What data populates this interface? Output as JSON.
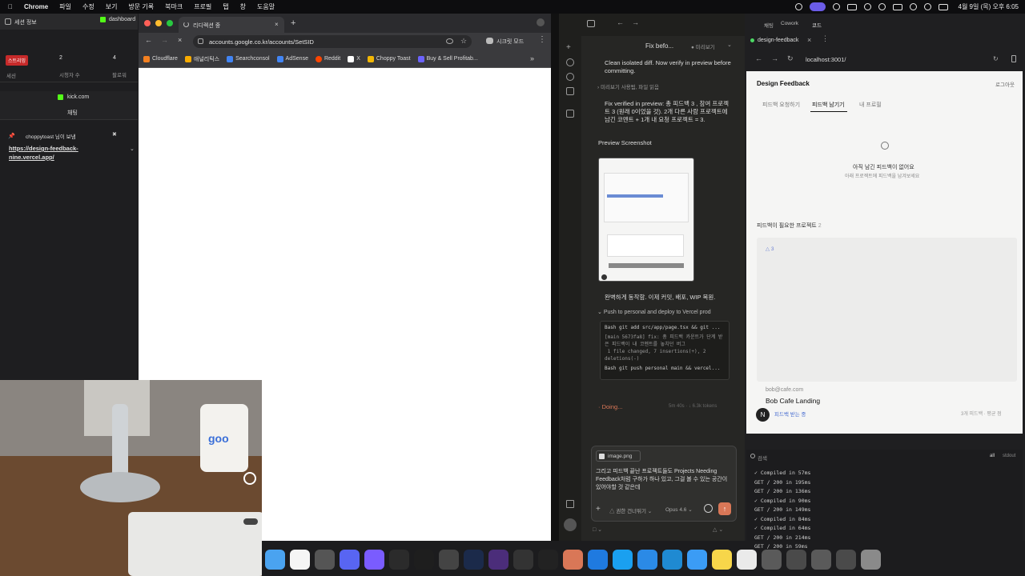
{
  "menubar": {
    "app": "Chrome",
    "items": [
      "파일",
      "수정",
      "보기",
      "방문 기록",
      "북마크",
      "프로필",
      "탭",
      "창",
      "도움말"
    ],
    "datetime": "4월 9일 (목) 오후 6:05"
  },
  "left_panel": {
    "session_title": "세션 정보",
    "dashboard_tab": "dashboard",
    "live_badge": "스트리밍",
    "session_label": "세션",
    "viewers_count": "2",
    "viewers_label": "시청자 수",
    "followers_count": "4",
    "followers_label": "팔로워",
    "kick_title": "kick.com",
    "chat_label": "채팅",
    "pinned_user": "choppytoast 님이 보냄",
    "pinned_link": "https://design-feedback-nine.vercel.app/"
  },
  "chrome": {
    "tab_title": "리디렉션 중",
    "url": "accounts.google.co.kr/accounts/SetSID",
    "secret_mode": "시크릿 모드",
    "bookmarks": [
      {
        "label": "Cloudflare",
        "color": "#f38020"
      },
      {
        "label": "애널리틱스",
        "color": "#f9ab00"
      },
      {
        "label": "Searchconsol",
        "color": "#4285f4"
      },
      {
        "label": "AdSense",
        "color": "#4285f4"
      },
      {
        "label": "Reddit",
        "color": "#ff4500"
      },
      {
        "label": "X",
        "color": "#ffffff"
      },
      {
        "label": "Choppy Toast",
        "color": "#f2b705"
      },
      {
        "label": "Buy & Sell Profitab...",
        "color": "#6c63ff"
      }
    ]
  },
  "claude": {
    "header_title": "Fix befo...",
    "preview_toggle": "미리보기",
    "tabs": [
      "채팅",
      "Cowork",
      "코드"
    ],
    "msg1": "Clean isolated diff. Now verify in preview before committing.",
    "tool1": "미리보기 사용됨, 파일 읽음",
    "msg2": "Fix verified in preview: 총 피드백 3 , 참여 프로젝트 3 (원래 0이었을 것). 2개 다른 사람 프로젝트에 남긴 코멘트 + 1개 내 요청 프로젝트 = 3.",
    "preview_label": "Preview Screenshot",
    "msg3": "완벽하게 동작함. 이제 커밋, 배포, WIP 복원.",
    "push_label": "Push to personal and deploy to Vercel prod",
    "bash1": "Bash  git add src/app/page.tsx && git ...",
    "bash1_out": "[main 5673fa8] fix: 총 피드백 카운트가 단계 받은 피드백이 내 코멘트를 놓치던 버그\n 1 file changed, 7 insertions(+), 2 deletions(-)",
    "bash2": "Bash  git push personal main && vercel...",
    "doing": "Doing...",
    "doing_meta": "5m 40s · ↓ 6.3k tokens",
    "attachment": "image.png",
    "input_text": "그리고 피드백 끝난 프로젝트들도 Projects Needing Feedback처럼 구하가 하나 있고, 그걸 볼 수 있는 공간이 있어야할 것 같은데",
    "permission": "권한 건너뛰기",
    "model": "Opus 4.6"
  },
  "design_feedback": {
    "tab_label": "design-feedback",
    "address": "localhost:3001/",
    "app_title": "Design Feedback",
    "logout": "로그아웃",
    "tabs": [
      "피드백 요청하기",
      "피드백 남기기",
      "내 프로필"
    ],
    "empty_title": "아직 남긴 피드백이 없어요",
    "empty_sub": "아래 프로젝트에 피드백을 남겨보세요",
    "needing_label": "피드백이 필요한 프로젝트",
    "needing_count": "2",
    "card_count": "3",
    "card_email": "bob@cafe.com",
    "card_title": "Bob Cafe Landing",
    "card_status": "피드백 받는 중",
    "card_meta": "3개 피드백 · 평균 점",
    "avatar": "N"
  },
  "terminal": {
    "search": "검색",
    "filter_all": "all",
    "filter_stdout": "stdout",
    "lines": [
      "✓ Compiled in 57ms",
      "GET / 200 in 195ms",
      "GET / 200 in 136ms",
      "✓ Compiled in 90ms",
      "GET / 200 in 149ms",
      "✓ Compiled in 84ms",
      "✓ Compiled in 64ms",
      "GET / 200 in 214ms",
      "GET / 200 in 59ms"
    ]
  },
  "dock": {
    "icons": [
      {
        "name": "finder-icon",
        "color": "#4aa3f0"
      },
      {
        "name": "notion-icon",
        "color": "#f5f5f5"
      },
      {
        "name": "calculator-icon",
        "color": "#555"
      },
      {
        "name": "discord-icon",
        "color": "#5865f2"
      },
      {
        "name": "messenger-icon",
        "color": "#7a5cff"
      },
      {
        "name": "chatgpt-icon",
        "color": "#2b2b2b"
      },
      {
        "name": "figma-icon",
        "color": "#1e1e1e"
      },
      {
        "name": "cube-icon",
        "color": "#444"
      },
      {
        "name": "affinity-icon",
        "color": "#1b2a4a"
      },
      {
        "name": "obsidian-icon",
        "color": "#4b2d7a"
      },
      {
        "name": "arc-icon",
        "color": "#333"
      },
      {
        "name": "terminal-icon",
        "color": "#222"
      },
      {
        "name": "claude-icon",
        "color": "#d97757"
      },
      {
        "name": "appstore-icon",
        "color": "#1f7ae0"
      },
      {
        "name": "xcode-icon",
        "color": "#1aa0f0"
      },
      {
        "name": "files-icon",
        "color": "#2b8ae6"
      },
      {
        "name": "vscode-icon",
        "color": "#1f8ad2"
      },
      {
        "name": "mail-icon",
        "color": "#3b9cf5"
      },
      {
        "name": "notes-icon",
        "color": "#f7d64a"
      },
      {
        "name": "openai-icon",
        "color": "#eaeaea"
      },
      {
        "name": "screen-icon",
        "color": "#5a5a5a"
      },
      {
        "name": "windows-icon",
        "color": "#4a4a4a"
      },
      {
        "name": "doc-icon",
        "color": "#5a5a5a"
      },
      {
        "name": "phone-icon",
        "color": "#4a4a4a"
      },
      {
        "name": "trash-icon",
        "color": "#8a8a8a"
      }
    ]
  }
}
